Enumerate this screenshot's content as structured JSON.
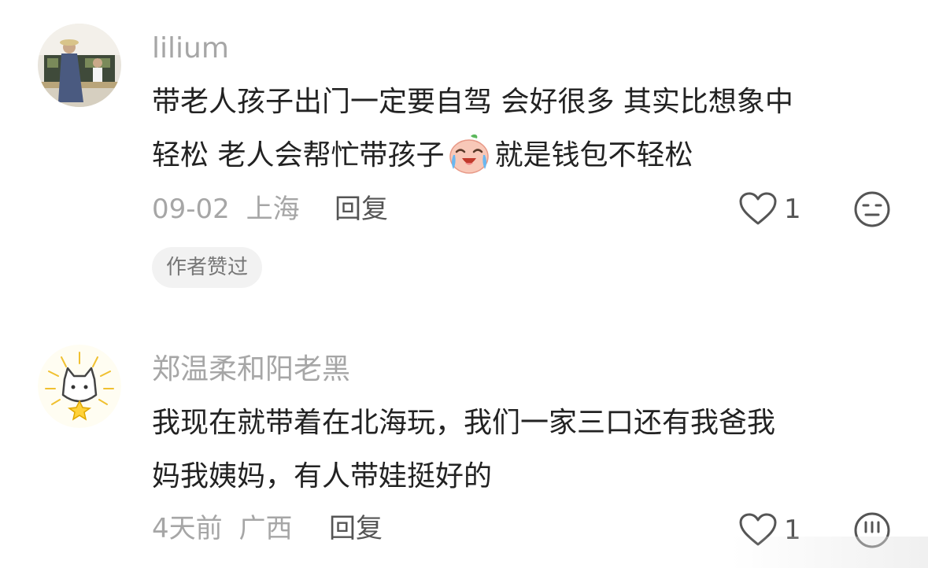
{
  "comments": [
    {
      "username": "lilium",
      "text_line1": "带老人孩子出门一定要自驾 会好很多 其实比想象中",
      "text_line2_a": "轻松 老人会帮忙带孩子",
      "text_line2_b": "就是钱包不轻松",
      "emoji": "crying-laughing-face-emoji",
      "date": "09-02",
      "location": "上海",
      "reply_label": "回复",
      "like_count": "1",
      "badge": "作者赞过",
      "icons": [
        "heart-icon",
        "neutral-face-icon"
      ]
    },
    {
      "username": "郑温柔和阳老黑",
      "text_line1": "我现在就带着在北海玩，我们一家三口还有我爸我",
      "text_line2": "妈我姨妈，有人带娃挺好的",
      "date": "4天前",
      "location": "广西",
      "reply_label": "回复",
      "like_count": "1",
      "icons": [
        "heart-icon",
        "sad-face-icon"
      ]
    }
  ],
  "colors": {
    "muted": "#a6a6a6",
    "text": "#222222",
    "badge_bg": "#f2f2f2"
  }
}
